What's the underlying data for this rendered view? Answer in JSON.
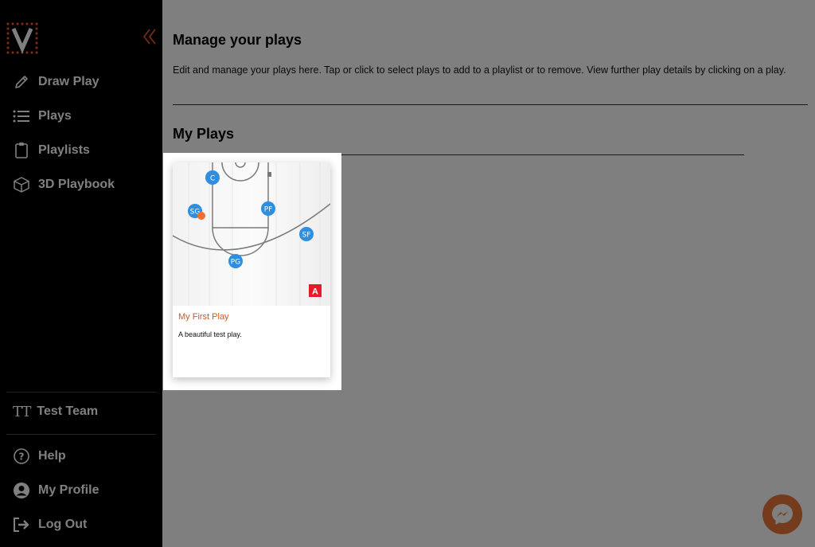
{
  "sidebar": {
    "logo_icon": "v-logo-icon",
    "collapse_icon": "double-chevron-left-icon",
    "nav": [
      {
        "label": "Draw Play",
        "icon": "pencil-icon"
      },
      {
        "label": "Plays",
        "icon": "list-icon"
      },
      {
        "label": "Playlists",
        "icon": "clipboard-icon"
      },
      {
        "label": "3D Playbook",
        "icon": "cube-icon"
      }
    ],
    "team": {
      "initials": "TT",
      "name": "Test Team"
    },
    "footer": [
      {
        "label": "Help",
        "icon": "question-circle-icon"
      },
      {
        "label": "My Profile",
        "icon": "user-circle-icon"
      },
      {
        "label": "Log Out",
        "icon": "logout-icon"
      }
    ]
  },
  "main": {
    "title": "Manage your plays",
    "description": "Edit and manage your plays here. Tap or click to select plays to add to a playlist or to remove. View further play details by clicking on a play.",
    "section_title": "My Plays"
  },
  "plays": [
    {
      "title": "My First Play",
      "description": "A beautiful test play.",
      "badge": "A",
      "players": [
        "C",
        "SG",
        "PF",
        "SF",
        "PG"
      ]
    }
  ],
  "colors": {
    "accent": "#d2561f",
    "player": "#2f8ee0",
    "badge": "#e8192c",
    "messenger": "#e8793a"
  },
  "messenger_icon": "messenger-icon"
}
